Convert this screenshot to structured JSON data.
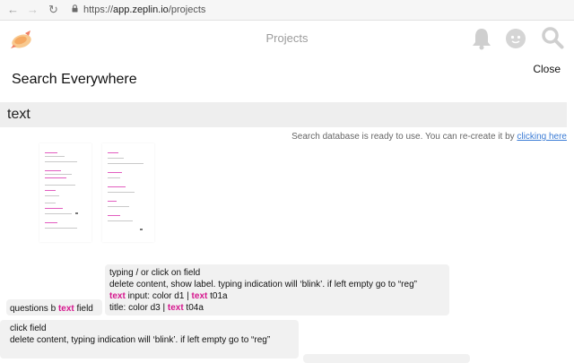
{
  "browser": {
    "back_icon": "arrow-left-icon",
    "forward_icon": "arrow-right-icon",
    "reload_icon": "reload-icon",
    "lock_icon": "lock-icon",
    "url_prefix": "https://",
    "url_host": "app.zeplin.io",
    "url_path": "/projects"
  },
  "header": {
    "title": "Projects",
    "icons": [
      "zeplin-logo-icon",
      "bell-icon",
      "avatar",
      "search-icon"
    ],
    "icon_color": "#c8c8c8",
    "logo_color": "#f5a962"
  },
  "search_panel": {
    "close_label": "Close",
    "title": "Search Everywhere",
    "query": "text",
    "status_text": "Search database is ready to use. You can re-create it by ",
    "status_link": "clicking here",
    "highlight_color": "#d6178e",
    "link_color": "#3a7bd5"
  },
  "results": [
    {
      "lines": [
        [
          {
            "t": "questions b "
          },
          {
            "t": "text",
            "hl": true
          },
          {
            "t": " field"
          }
        ]
      ]
    },
    {
      "lines": [
        [
          {
            "t": "typing / or click on field"
          }
        ],
        [
          {
            "t": "delete content, show label. typing indication will ‘blink’. if left empty go to “reg”"
          }
        ],
        [
          {
            "t": "text",
            "hl": true
          },
          {
            "t": " input: color d1 | "
          },
          {
            "t": "text",
            "hl": true
          },
          {
            "t": " t01a"
          }
        ],
        [
          {
            "t": "title: color d3 | "
          },
          {
            "t": "text",
            "hl": true
          },
          {
            "t": " t04a"
          }
        ]
      ]
    },
    {
      "lines": [
        [
          {
            "t": "click field"
          }
        ],
        [
          {
            "t": "delete content, typing indication will ‘blink’. if left empty go to “reg”"
          }
        ]
      ]
    }
  ]
}
